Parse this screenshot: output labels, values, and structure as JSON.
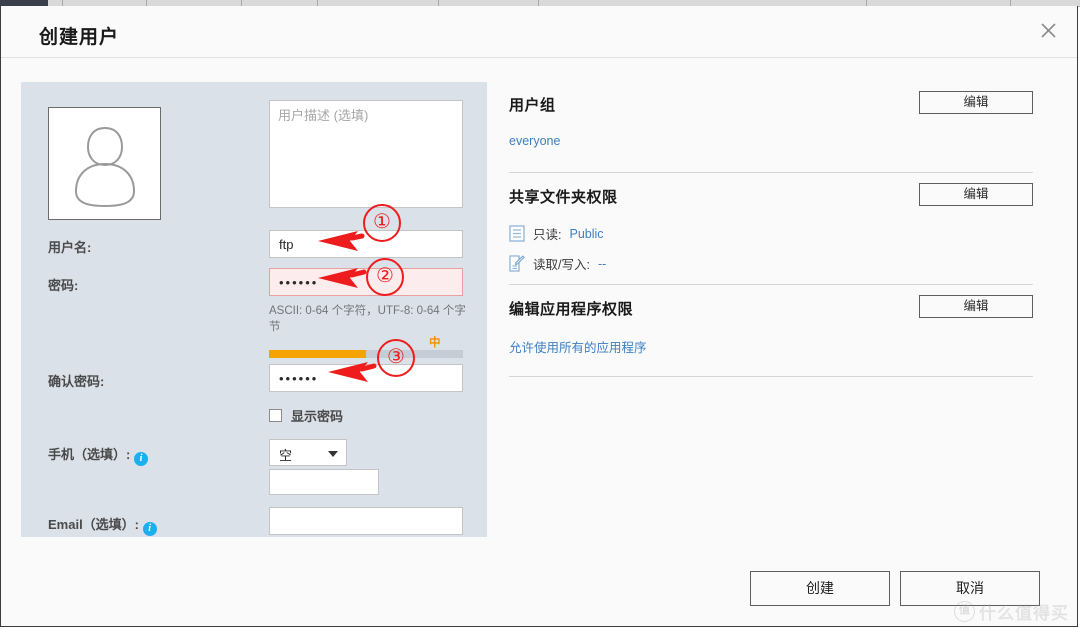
{
  "window": {
    "title": "创建用户",
    "close_icon": "close-icon"
  },
  "form": {
    "avatar_icon": "user-avatar-icon",
    "description": {
      "placeholder": "用户描述 (选填)",
      "value": ""
    },
    "username": {
      "label": "用户名:",
      "value": "ftp"
    },
    "password": {
      "label": "密码:",
      "value": "••••••",
      "error_state": true,
      "hint": "ASCII: 0-64 个字符，UTF-8: 0-64 个字节",
      "strength_label": "中",
      "strength_percent": 50,
      "strength_color": "#f5a300"
    },
    "confirm_password": {
      "label": "确认密码:",
      "value": "••••••"
    },
    "show_password": {
      "label": "显示密码",
      "checked": false
    },
    "phone": {
      "label": "手机（选填）:",
      "info_icon": "info-icon",
      "selected": "空",
      "options": [
        "空"
      ],
      "number_value": ""
    },
    "email": {
      "label": "Email（选填）:",
      "info_icon": "info-icon",
      "value": ""
    }
  },
  "panels": {
    "user_group": {
      "title": "用户组",
      "edit_label": "编辑",
      "value": "everyone"
    },
    "shared_folder": {
      "title": "共享文件夹权限",
      "edit_label": "编辑",
      "rows": [
        {
          "icon": "read-only-icon",
          "label": "只读:",
          "value": "Public"
        },
        {
          "icon": "read-write-icon",
          "label": "读取/写入:",
          "value": "--"
        }
      ]
    },
    "app_permission": {
      "title": "编辑应用程序权限",
      "edit_label": "编辑",
      "value": "允许使用所有的应用程序"
    }
  },
  "footer": {
    "create_label": "创建",
    "cancel_label": "取消"
  },
  "watermark": {
    "logo": "值",
    "text": "什么值得买"
  },
  "annotations": {
    "markers": [
      "①",
      "②",
      "③"
    ],
    "color": "#ee1c1c"
  }
}
